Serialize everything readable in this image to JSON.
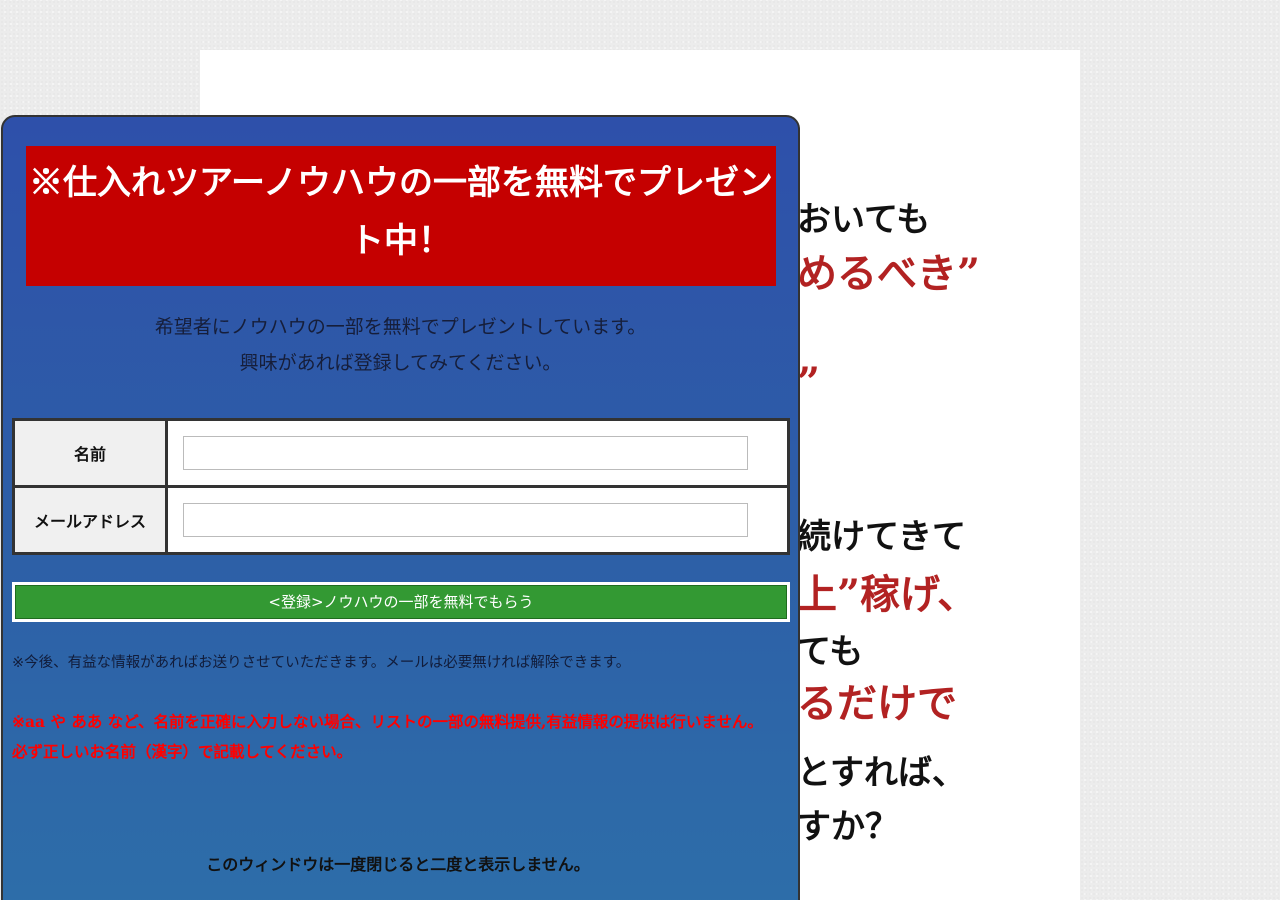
{
  "background_page": {
    "lines": [
      {
        "text": "おいても",
        "color": "black"
      },
      {
        "text": "めるべき”",
        "color": "red"
      },
      {
        "text": "”",
        "color": "red"
      },
      {
        "text": "続けてきて",
        "color": "black"
      },
      {
        "text": "上”稼げ、",
        "color": "red"
      },
      {
        "text": "ても",
        "color": "black"
      },
      {
        "text": "るだけで",
        "color": "red"
      },
      {
        "text": "とすれば、",
        "color": "black"
      },
      {
        "text": "すか？",
        "color": "black"
      }
    ]
  },
  "popup": {
    "headline": "※仕入れツアーノウハウの一部を無料でプレゼント中！",
    "intro_line_1": "希望者にノウハウの一部を無料でプレゼントしています。",
    "intro_line_2": "興味があれば登録してみてください。",
    "form": {
      "name_label": "名前",
      "name_value": "",
      "email_label": "メールアドレス",
      "email_value": ""
    },
    "submit_label": "<登録>ノウハウの一部を無料でもらう",
    "note": "※今後、有益な情報があればお送りさせていただきます。メールは必要無ければ解除できます。",
    "warning_line_1": "※aa や ああ など、名前を正確に入力しない場合、リストの一部の無料提供,有益情報の提供は行いません。",
    "warning_line_2": "必ず正しいお名前（漢字）で記載してください。",
    "close_note": "このウィンドウは一度閉じると二度と表示しません。"
  },
  "colors": {
    "popup_bg_top": "#2e50aa",
    "headline_bg": "#c50000",
    "submit_bg": "#339933",
    "warning_text": "#ff0000"
  }
}
